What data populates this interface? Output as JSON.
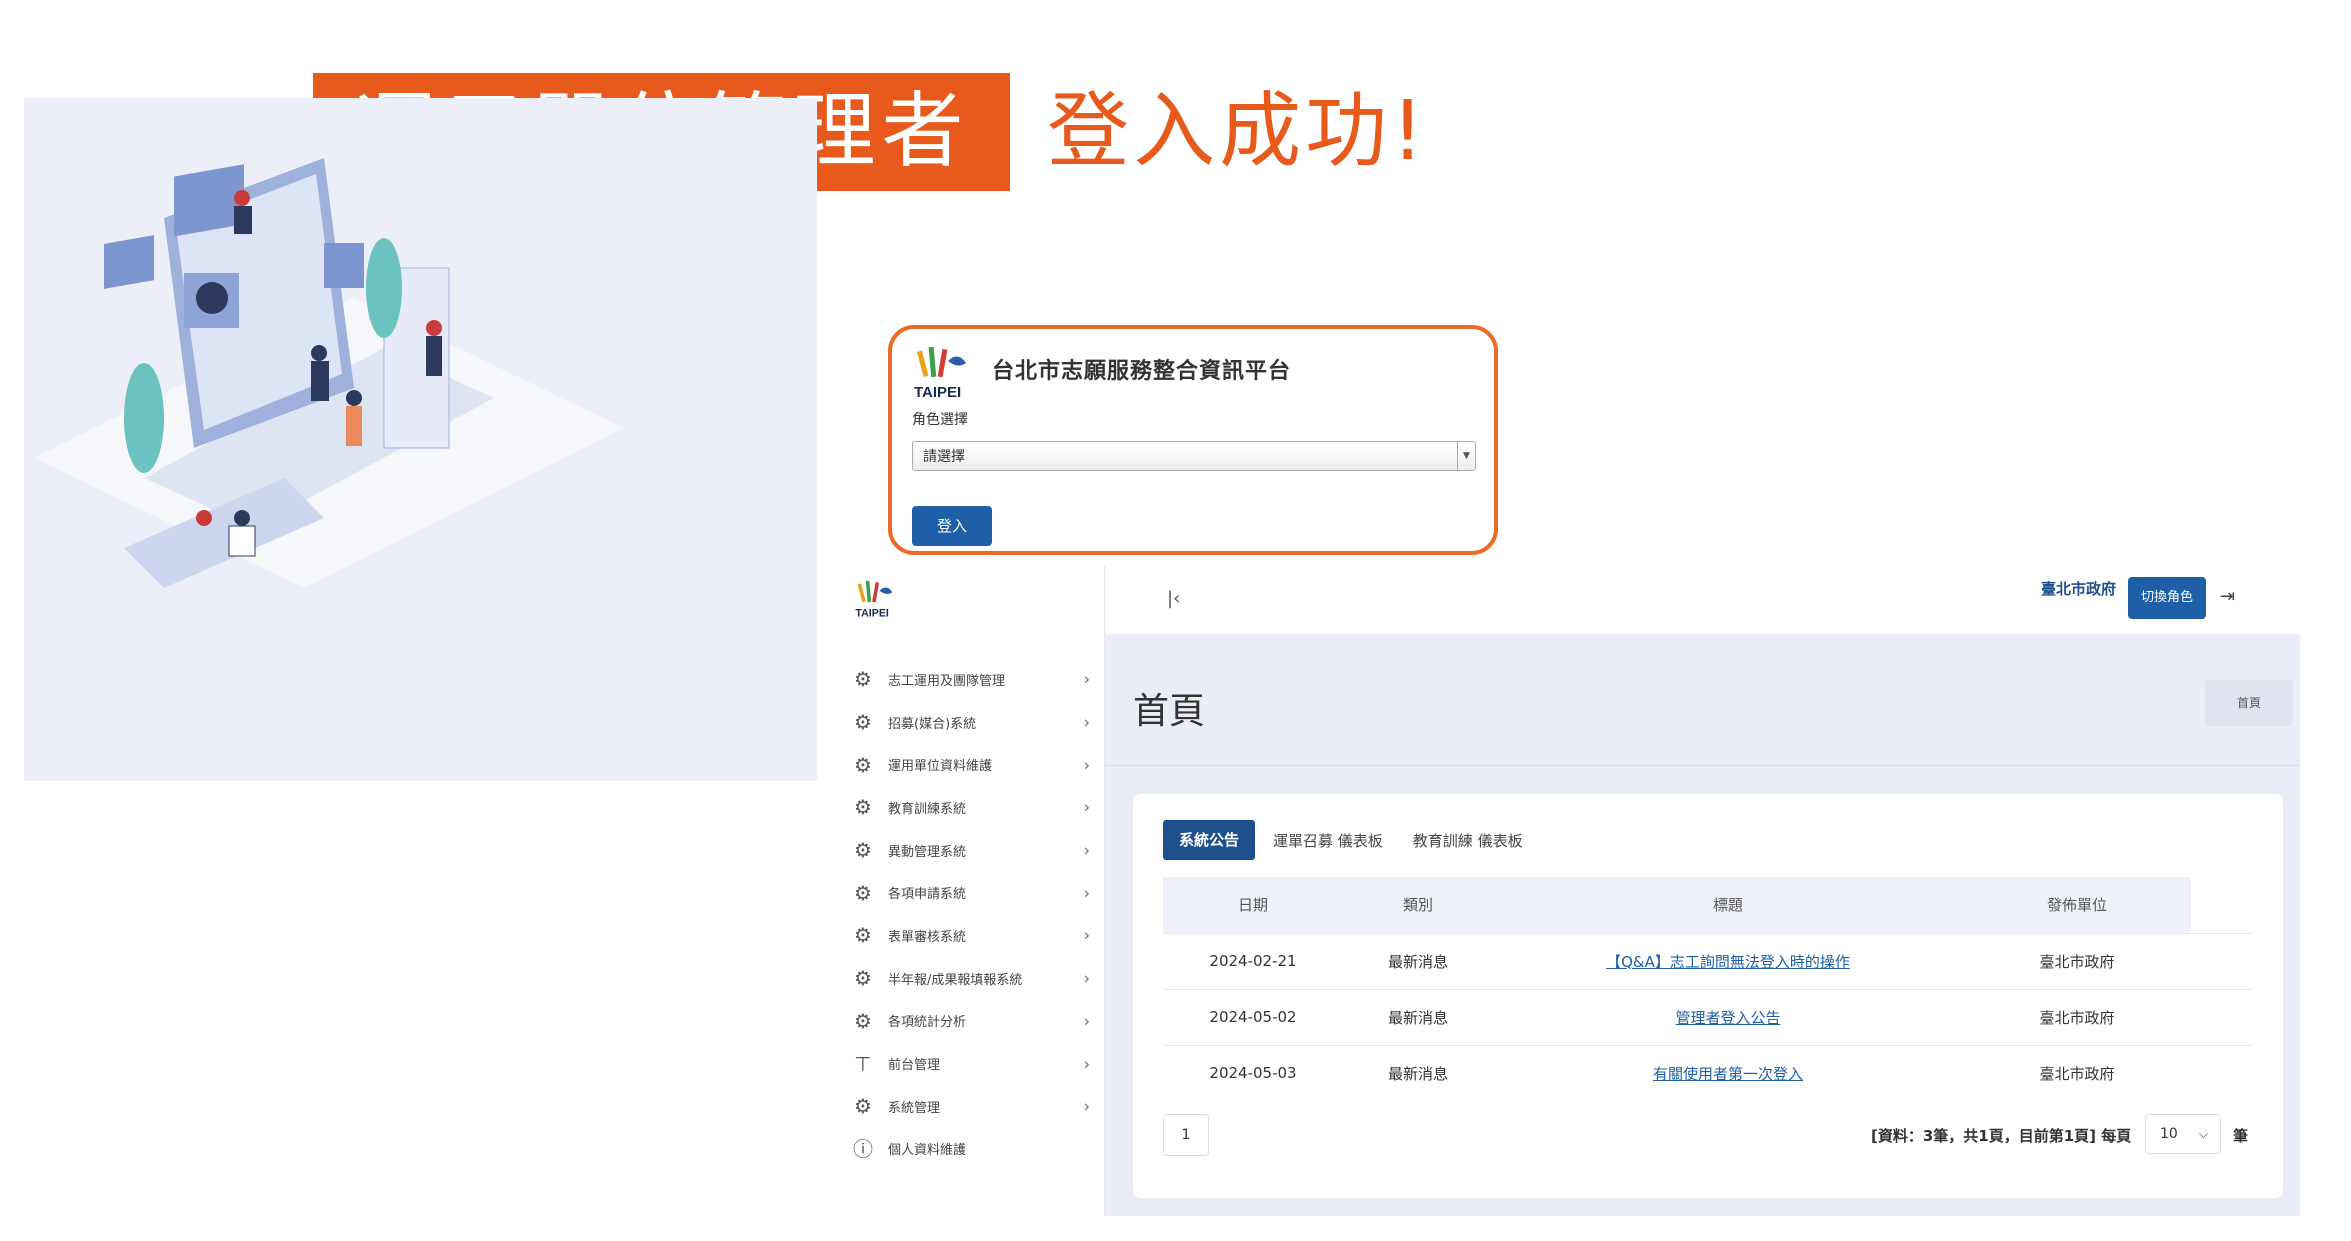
{
  "banner": {
    "role": "運用單位管理者",
    "status": "登入成功!"
  },
  "brand": {
    "logo_text": "TAIPEI",
    "orange": "#e85a1b",
    "blue": "#1f5fa8"
  },
  "login": {
    "site_title": "台北市志願服務整合資訊平台",
    "role_label": "角色選擇",
    "role_select_value": "請選擇",
    "login_button": "登入"
  },
  "header": {
    "collapse_icon": "collapse-left-icon",
    "org": "臺北市政府",
    "switch_role_button": "切換角色",
    "logout_icon": "logout-icon"
  },
  "sidebar": {
    "items": [
      {
        "label": "志工運用及團隊管理",
        "icon": "gear-icon"
      },
      {
        "label": "招募(媒合)系統",
        "icon": "gear-icon"
      },
      {
        "label": "運用單位資料維護",
        "icon": "gear-icon"
      },
      {
        "label": "教育訓練系統",
        "icon": "gear-icon"
      },
      {
        "label": "異動管理系統",
        "icon": "gear-icon"
      },
      {
        "label": "各項申請系統",
        "icon": "gear-icon"
      },
      {
        "label": "表單審核系統",
        "icon": "gear-icon"
      },
      {
        "label": "半年報/成果報填報系統",
        "icon": "gear-icon"
      },
      {
        "label": "各項統計分析",
        "icon": "gear-icon"
      },
      {
        "label": "前台管理",
        "icon": "paint-roller-icon"
      },
      {
        "label": "系統管理",
        "icon": "gear-icon"
      },
      {
        "label": "個人資料維護",
        "icon": "info-icon"
      }
    ]
  },
  "main": {
    "page_title": "首頁",
    "breadcrumb": "首頁",
    "tabs": [
      {
        "label": "系統公告",
        "active": true
      },
      {
        "label": "運單召募 儀表板",
        "active": false
      },
      {
        "label": "教育訓練 儀表板",
        "active": false
      }
    ],
    "table": {
      "headers": [
        "日期",
        "類別",
        "標題",
        "發佈單位"
      ],
      "rows": [
        {
          "date": "2024-02-21",
          "category": "最新消息",
          "title": "【Q&A】志工詢問無法登入時的操作",
          "unit": "臺北市政府"
        },
        {
          "date": "2024-05-02",
          "category": "最新消息",
          "title": "管理者登入公告",
          "unit": "臺北市政府"
        },
        {
          "date": "2024-05-03",
          "category": "最新消息",
          "title": "有關使用者第一次登入",
          "unit": "臺北市政府"
        }
      ]
    },
    "pagination": {
      "page": "1",
      "info": "[資料：3筆，共1頁，目前第1頁] 每頁",
      "per_page": "10",
      "unit": "筆"
    }
  }
}
